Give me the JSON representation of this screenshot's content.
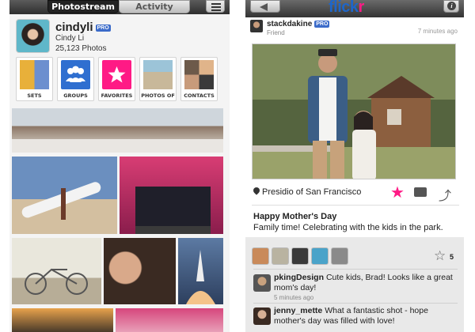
{
  "left_screen": {
    "tabs": [
      {
        "label": "Photostream",
        "active": true
      },
      {
        "label": "Activity",
        "active": false
      }
    ],
    "menu_icon": "list-icon",
    "profile": {
      "username": "cindyli",
      "badge": "PRO",
      "real_name": "Cindy Li",
      "photo_count": "25,123 Photos"
    },
    "tiles": [
      {
        "label": "SETS",
        "icon": "sets-collage"
      },
      {
        "label": "GROUPS",
        "icon": "groups-icon"
      },
      {
        "label": "FAVORITES",
        "icon": "star-icon"
      },
      {
        "label": "PHOTOS OF",
        "icon": "people-photo"
      },
      {
        "label": "CONTACTS",
        "icon": "contacts-collage"
      }
    ],
    "photos": [
      "city-wall-panorama",
      "beach-surfboard",
      "group-photo",
      "bicycle",
      "mother-baby",
      "rocket-launch",
      "sunset",
      "pink-flowers"
    ]
  },
  "right_screen": {
    "logo": {
      "part1": "flick",
      "part2": "r"
    },
    "back_icon": "back-arrow-icon",
    "info_icon": "info-icon",
    "poster": {
      "name": "stackdakine",
      "badge": "PRO",
      "relation": "Friend",
      "time": "7 minutes ago"
    },
    "location": "Presidio of San Francisco",
    "favorited": true,
    "caption": {
      "title": "Happy Mother's Day",
      "text": "Family time! Celebrating with the kids in the park."
    },
    "fav_count": "5",
    "comments": [
      {
        "author": "pkingDesign",
        "text": "Cute kids, Brad! Looks like a great mom's day!",
        "time": "5 minutes ago"
      },
      {
        "author": "jenny_mette",
        "text": "What a fantastic shot - hope mother's day was filled with love!",
        "time": ""
      }
    ],
    "colors": {
      "flickr_blue": "#1e66c9",
      "flickr_pink": "#ff1a85"
    }
  }
}
